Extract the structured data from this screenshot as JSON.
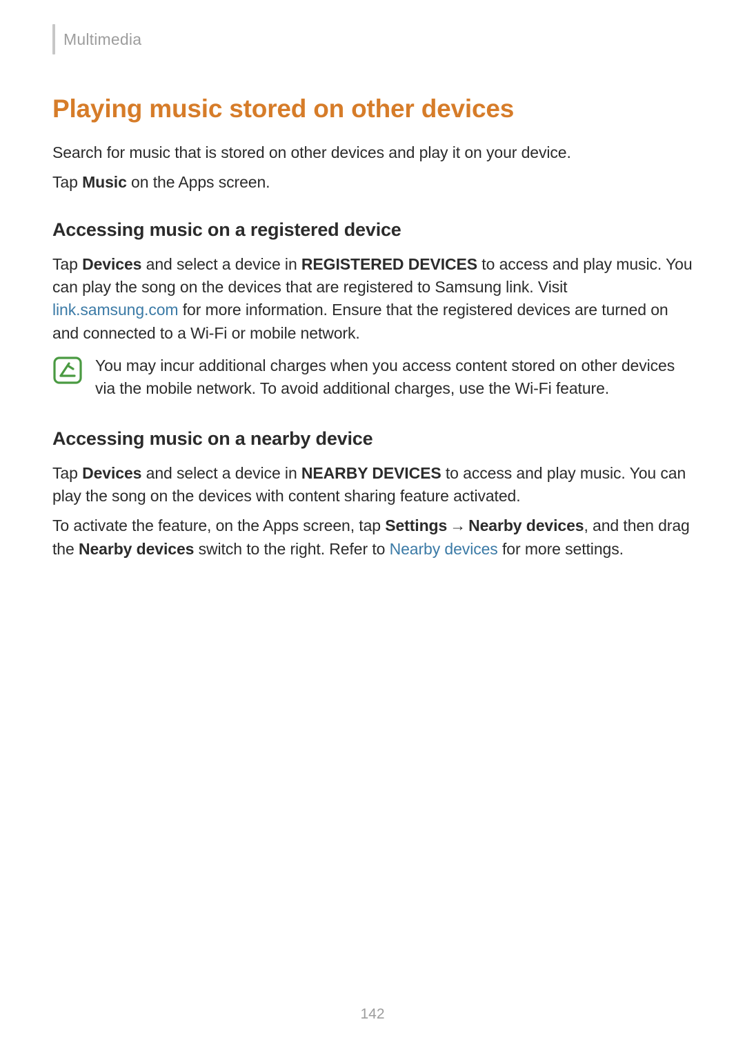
{
  "header": {
    "breadcrumb": "Multimedia"
  },
  "main": {
    "title": "Playing music stored on other devices",
    "intro_p1": "Search for music that is stored on other devices and play it on your device.",
    "intro_p2_a": "Tap ",
    "intro_p2_bold": "Music",
    "intro_p2_b": " on the Apps screen.",
    "section1": {
      "heading": "Accessing music on a registered device",
      "p1_a": "Tap ",
      "p1_bold1": "Devices",
      "p1_b": " and select a device in ",
      "p1_bold2": "REGISTERED DEVICES",
      "p1_c": " to access and play music. You can play the song on the devices that are registered to Samsung link. Visit ",
      "p1_link": "link.samsung.com",
      "p1_d": " for more information. Ensure that the registered devices are turned on and connected to a Wi-Fi or mobile network.",
      "note": "You may incur additional charges when you access content stored on other devices via the mobile network. To avoid additional charges, use the Wi-Fi feature."
    },
    "section2": {
      "heading": "Accessing music on a nearby device",
      "p1_a": "Tap ",
      "p1_bold1": "Devices",
      "p1_b": " and select a device in ",
      "p1_bold2": "NEARBY DEVICES",
      "p1_c": " to access and play music. You can play the song on the devices with content sharing feature activated.",
      "p2_a": "To activate the feature, on the Apps screen, tap ",
      "p2_bold1": "Settings",
      "p2_arrow": "→",
      "p2_bold2": "Nearby devices",
      "p2_b": ", and then drag the ",
      "p2_bold3": "Nearby devices",
      "p2_c": " switch to the right. Refer to ",
      "p2_link": "Nearby devices",
      "p2_d": " for more settings."
    }
  },
  "footer": {
    "page_number": "142"
  },
  "icons": {
    "note": "note-icon"
  }
}
